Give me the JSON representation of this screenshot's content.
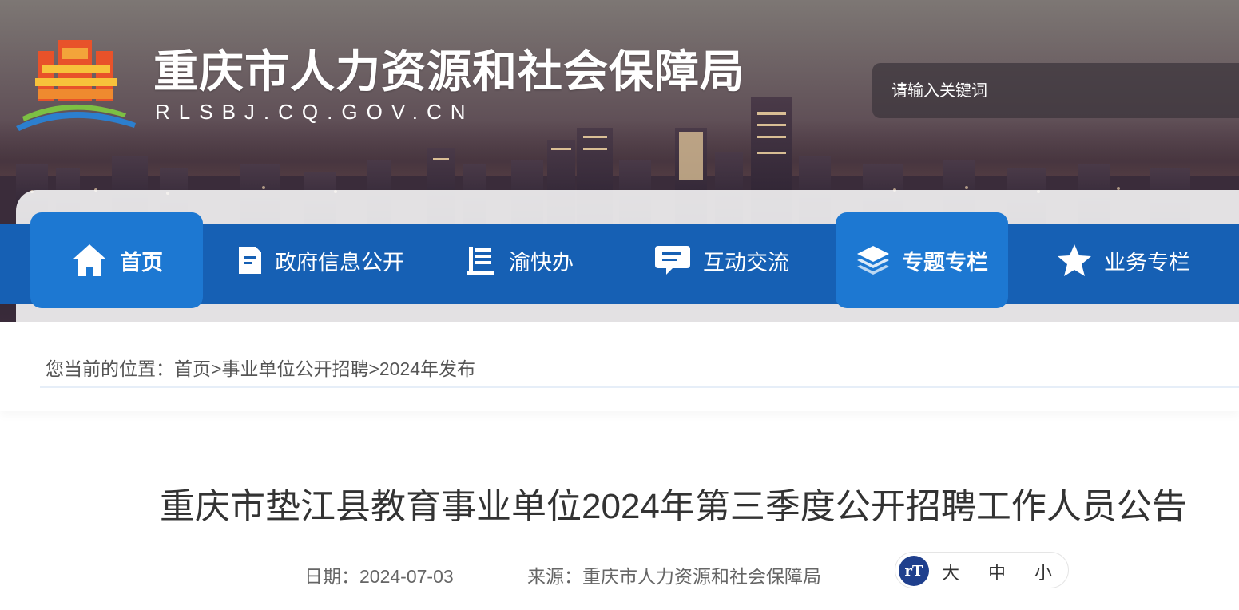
{
  "header": {
    "site_title": "重庆市人力资源和社会保障局",
    "site_domain": "RLSBJ.CQ.GOV.CN",
    "search_placeholder": "请输入关键词"
  },
  "nav": {
    "items": [
      {
        "label": "首页",
        "icon": "home-icon",
        "active": true
      },
      {
        "label": "政府信息公开",
        "icon": "document-icon",
        "active": false
      },
      {
        "label": "渝快办",
        "icon": "list-book-icon",
        "active": false
      },
      {
        "label": "互动交流",
        "icon": "chat-bubble-icon",
        "active": false
      },
      {
        "label": "专题专栏",
        "icon": "layers-icon",
        "active": true
      },
      {
        "label": "业务专栏",
        "icon": "star-icon",
        "active": false
      }
    ]
  },
  "breadcrumb": {
    "prefix": "您当前的位置：",
    "links": [
      "首页",
      "事业单位公开招聘",
      "2024年发布"
    ],
    "separator": ">"
  },
  "article": {
    "title": "重庆市垫江县教育事业单位2024年第三季度公开招聘工作人员公告",
    "date": "日期：2024-07-03",
    "source": "来源：重庆市人力资源和社会保障局",
    "font_size": {
      "icon_text": "rT",
      "options": [
        "大",
        "中",
        "小"
      ]
    }
  },
  "colors": {
    "nav_bg": "#1660b4",
    "nav_active_bg": "#1d78d2",
    "title_text": "#333333"
  }
}
